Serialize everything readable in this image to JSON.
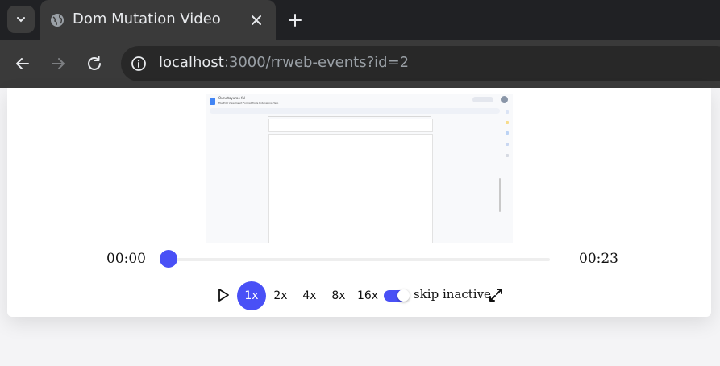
{
  "browser": {
    "tab_title": "Dom Mutation Video",
    "url_host": "localhost",
    "url_rest": ":3000/rrweb-events?id=2"
  },
  "replay_frame": {
    "doc_title": "Ouruttoyuroo fal",
    "doc_menu": "File  Edit  View  Insert  Format  Tools  Extensions  Help"
  },
  "player": {
    "current_time": "00:00",
    "total_time": "00:23",
    "progress": 0,
    "speeds": [
      "1x",
      "2x",
      "4x",
      "8x",
      "16x"
    ],
    "active_speed": "1x",
    "skip_inactive_label": "skip inactive",
    "skip_inactive_on": true
  },
  "colors": {
    "accent": "#4950f6",
    "chrome_dark": "#202124",
    "chrome_mid": "#3a3a3a"
  }
}
